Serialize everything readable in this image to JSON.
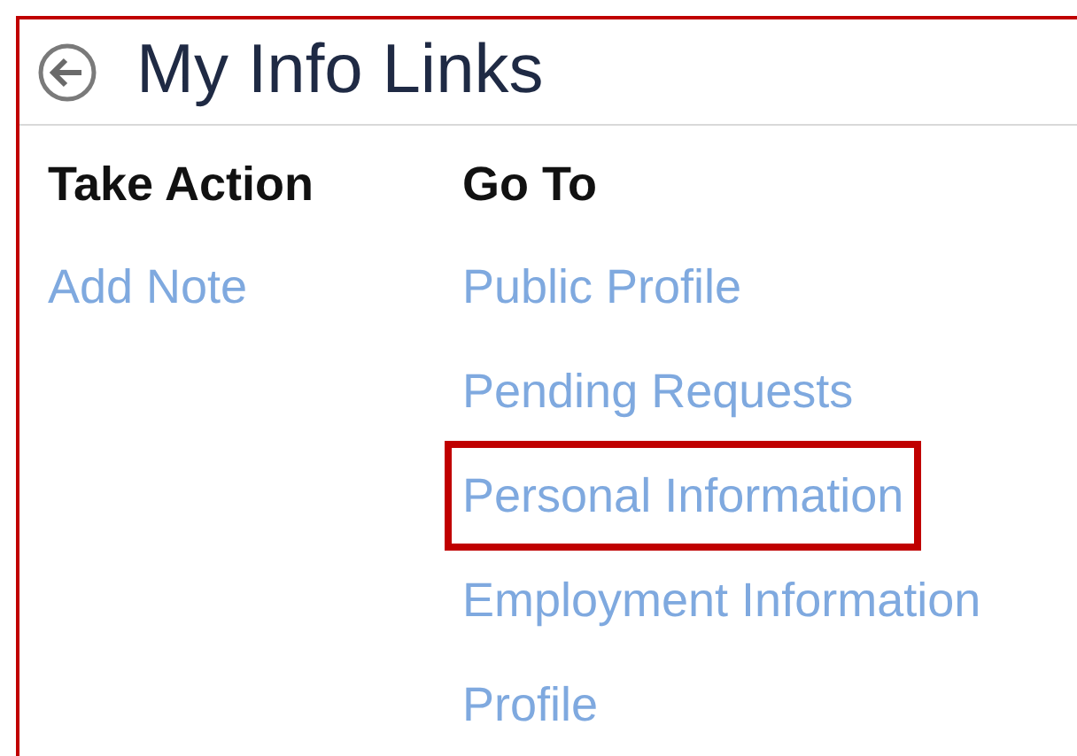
{
  "panel": {
    "title": "My Info Links"
  },
  "columns": [
    {
      "heading": "Take Action",
      "links": [
        {
          "label": "Add Note",
          "highlighted": false
        }
      ]
    },
    {
      "heading": "Go To",
      "links": [
        {
          "label": "Public Profile",
          "highlighted": false
        },
        {
          "label": "Pending Requests",
          "highlighted": false
        },
        {
          "label": "Personal Information",
          "highlighted": true
        },
        {
          "label": "Employment Information",
          "highlighted": false
        },
        {
          "label": "Profile",
          "highlighted": false
        }
      ]
    }
  ]
}
